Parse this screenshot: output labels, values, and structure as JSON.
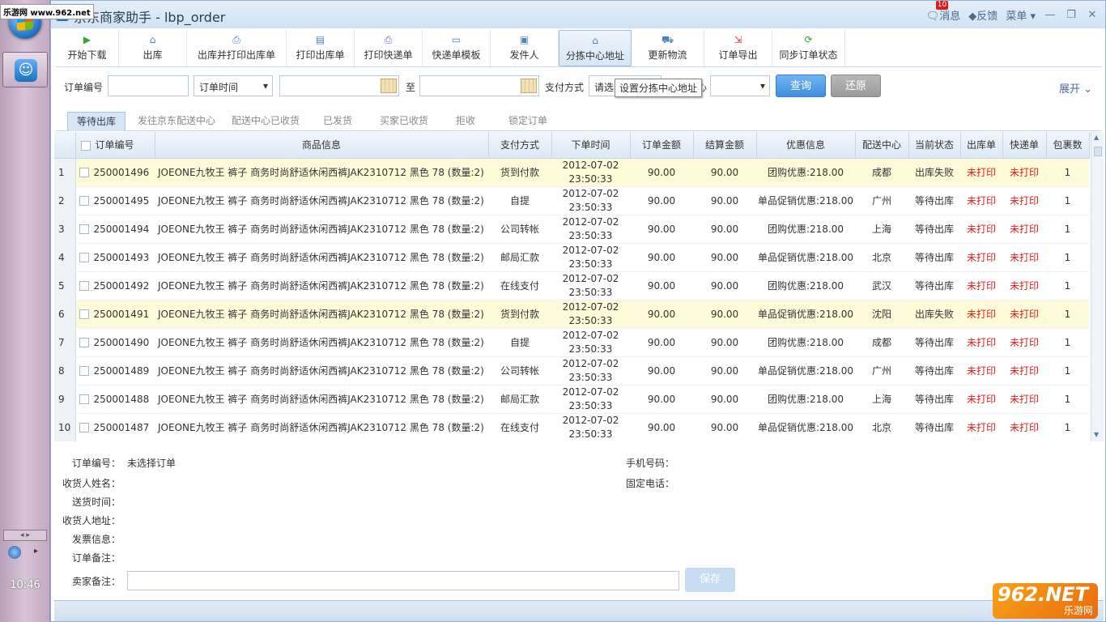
{
  "taskbar": {
    "site_badge": "乐游网 www.962.net",
    "clock": "10:46"
  },
  "window": {
    "title": "京东商家助手 - lbp_order",
    "messages_label": "消息",
    "messages_count": "10",
    "feedback_label": "反馈",
    "menu_label": "菜单"
  },
  "toolbar": {
    "items": [
      {
        "label": "开始下载",
        "icon": "play-icon"
      },
      {
        "label": "出库",
        "icon": "home-icon"
      },
      {
        "label": "出库并打印出库单",
        "icon": "print-stack-icon"
      },
      {
        "label": "打印出库单",
        "icon": "print-doc-icon"
      },
      {
        "label": "打印快递单",
        "icon": "printer-icon"
      },
      {
        "label": "快递单模板",
        "icon": "template-icon"
      },
      {
        "label": "发件人",
        "icon": "card-icon"
      },
      {
        "label": "分拣中心地址",
        "icon": "sorting-center-icon"
      },
      {
        "label": "更新物流",
        "icon": "truck-icon"
      },
      {
        "label": "订单导出",
        "icon": "export-icon"
      },
      {
        "label": "同步订单状态",
        "icon": "sync-icon"
      }
    ]
  },
  "filter": {
    "order_no_label": "订单编号",
    "order_no_value": "",
    "time_select": "订单时间",
    "date_from": "",
    "to_label": "至",
    "date_to": "",
    "pay_label": "支付方式",
    "pay_value": "请选",
    "center_label_tail": "心",
    "center_value": "",
    "tooltip": "设置分拣中心地址",
    "query_button": "查询",
    "reset_button": "还原",
    "expand_label": "展开"
  },
  "tabs": [
    {
      "label": "等待出库",
      "active": true
    },
    {
      "label": "发往京东配送中心",
      "active": false
    },
    {
      "label": "配送中心已收货",
      "active": false
    },
    {
      "label": "已发货",
      "active": false
    },
    {
      "label": "买家已收货",
      "active": false
    },
    {
      "label": "拒收",
      "active": false
    },
    {
      "label": "锁定订单",
      "active": false
    }
  ],
  "table": {
    "headers": [
      "订单编号",
      "商品信息",
      "支付方式",
      "下单时间",
      "订单金额",
      "结算金额",
      "优惠信息",
      "配送中心",
      "当前状态",
      "出库单",
      "快递单",
      "包裹数"
    ],
    "rows": [
      {
        "n": "1",
        "id": "250001496",
        "product": "JOEONE九牧王 裤子 商务时尚舒适休闲西裤JAK2310712 黑色 78 (数量:2)",
        "pay": "货到付款",
        "date": "2012-07-02",
        "time": "23:50:33",
        "amount": "90.00",
        "settle": "90.00",
        "promo": "团购优惠:218.00",
        "center": "成都",
        "status": "出库失败",
        "out": "未打印",
        "express": "未打印",
        "pkgs": "1",
        "hl": true
      },
      {
        "n": "2",
        "id": "250001495",
        "product": "JOEONE九牧王 裤子 商务时尚舒适休闲西裤JAK2310712 黑色 78 (数量:2)",
        "pay": "自提",
        "date": "2012-07-02",
        "time": "23:50:33",
        "amount": "90.00",
        "settle": "90.00",
        "promo": "单品促销优惠:218.00",
        "center": "广州",
        "status": "等待出库",
        "out": "未打印",
        "express": "未打印",
        "pkgs": "1",
        "hl": false
      },
      {
        "n": "3",
        "id": "250001494",
        "product": "JOEONE九牧王 裤子 商务时尚舒适休闲西裤JAK2310712 黑色 78 (数量:2)",
        "pay": "公司转帐",
        "date": "2012-07-02",
        "time": "23:50:33",
        "amount": "90.00",
        "settle": "90.00",
        "promo": "团购优惠:218.00",
        "center": "上海",
        "status": "等待出库",
        "out": "未打印",
        "express": "未打印",
        "pkgs": "1",
        "hl": false
      },
      {
        "n": "4",
        "id": "250001493",
        "product": "JOEONE九牧王 裤子 商务时尚舒适休闲西裤JAK2310712 黑色 78 (数量:2)",
        "pay": "邮局汇款",
        "date": "2012-07-02",
        "time": "23:50:33",
        "amount": "90.00",
        "settle": "90.00",
        "promo": "单品促销优惠:218.00",
        "center": "北京",
        "status": "等待出库",
        "out": "未打印",
        "express": "未打印",
        "pkgs": "1",
        "hl": false
      },
      {
        "n": "5",
        "id": "250001492",
        "product": "JOEONE九牧王 裤子 商务时尚舒适休闲西裤JAK2310712 黑色 78 (数量:2)",
        "pay": "在线支付",
        "date": "2012-07-02",
        "time": "23:50:33",
        "amount": "90.00",
        "settle": "90.00",
        "promo": "团购优惠:218.00",
        "center": "武汉",
        "status": "等待出库",
        "out": "未打印",
        "express": "未打印",
        "pkgs": "1",
        "hl": false
      },
      {
        "n": "6",
        "id": "250001491",
        "product": "JOEONE九牧王 裤子 商务时尚舒适休闲西裤JAK2310712 黑色 78 (数量:2)",
        "pay": "货到付款",
        "date": "2012-07-02",
        "time": "23:50:33",
        "amount": "90.00",
        "settle": "90.00",
        "promo": "单品促销优惠:218.00",
        "center": "沈阳",
        "status": "出库失败",
        "out": "未打印",
        "express": "未打印",
        "pkgs": "1",
        "hl": true
      },
      {
        "n": "7",
        "id": "250001490",
        "product": "JOEONE九牧王 裤子 商务时尚舒适休闲西裤JAK2310712 黑色 78 (数量:2)",
        "pay": "自提",
        "date": "2012-07-02",
        "time": "23:50:33",
        "amount": "90.00",
        "settle": "90.00",
        "promo": "团购优惠:218.00",
        "center": "成都",
        "status": "等待出库",
        "out": "未打印",
        "express": "未打印",
        "pkgs": "1",
        "hl": false
      },
      {
        "n": "8",
        "id": "250001489",
        "product": "JOEONE九牧王 裤子 商务时尚舒适休闲西裤JAK2310712 黑色 78 (数量:2)",
        "pay": "公司转帐",
        "date": "2012-07-02",
        "time": "23:50:33",
        "amount": "90.00",
        "settle": "90.00",
        "promo": "单品促销优惠:218.00",
        "center": "广州",
        "status": "等待出库",
        "out": "未打印",
        "express": "未打印",
        "pkgs": "1",
        "hl": false
      },
      {
        "n": "9",
        "id": "250001488",
        "product": "JOEONE九牧王 裤子 商务时尚舒适休闲西裤JAK2310712 黑色 78 (数量:2)",
        "pay": "邮局汇款",
        "date": "2012-07-02",
        "time": "23:50:33",
        "amount": "90.00",
        "settle": "90.00",
        "promo": "团购优惠:218.00",
        "center": "上海",
        "status": "等待出库",
        "out": "未打印",
        "express": "未打印",
        "pkgs": "1",
        "hl": false
      },
      {
        "n": "10",
        "id": "250001487",
        "product": "JOEONE九牧王 裤子 商务时尚舒适休闲西裤JAK2310712 黑色 78 (数量:2)",
        "pay": "在线支付",
        "date": "2012-07-02",
        "time": "23:50:33",
        "amount": "90.00",
        "settle": "90.00",
        "promo": "单品促销优惠:218.00",
        "center": "北京",
        "status": "等待出库",
        "out": "未打印",
        "express": "未打印",
        "pkgs": "1",
        "hl": false
      }
    ]
  },
  "details": {
    "order_no_label": "订单编号：",
    "order_no_value": "未选择订单",
    "receiver_label": "收货人姓名：",
    "delivery_time_label": "送货时间：",
    "address_label": "收货人地址：",
    "invoice_label": "发票信息：",
    "order_note_label": "订单备注：",
    "seller_note_label": "卖家备注：",
    "seller_note_value": "",
    "mobile_label": "手机号码：",
    "phone_label": "固定电话：",
    "save_button": "保存"
  },
  "watermark": {
    "big": "962.NET",
    "small": "乐游网"
  },
  "colors": {
    "accent": "#4da0ec",
    "highlight_row": "#fdfbd8",
    "unprinted": "#e01b1b"
  }
}
